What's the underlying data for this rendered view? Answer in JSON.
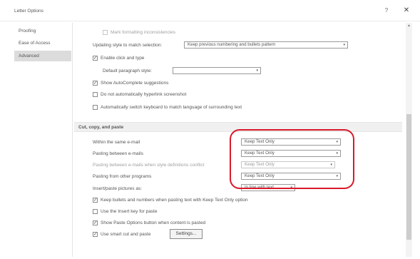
{
  "window": {
    "title": "Letter Options",
    "help_icon": "?",
    "close_icon": "✕"
  },
  "sidebar": {
    "items": [
      {
        "label": "Proofing",
        "active": false
      },
      {
        "label": "Ease of Access",
        "active": false
      },
      {
        "label": "Advanced",
        "active": true
      }
    ]
  },
  "editing": {
    "show_formatting_inconsistencies": {
      "label": "Mark formatting inconsistencies",
      "checked": false,
      "enabled": false
    },
    "updating_style": {
      "label": "Updating style to match selection:",
      "value": "Keep previous numbering and bullets pattern"
    },
    "enable_click_and_type": {
      "label": "Enable click and type",
      "checked": true
    },
    "default_paragraph_style": {
      "label": "Default paragraph style:",
      "value": ""
    },
    "show_autocomplete": {
      "label": "Show AutoComplete suggestions",
      "checked": true
    },
    "no_auto_hyperlink": {
      "label": "Do not automatically hyperlink screenshot",
      "checked": false
    },
    "auto_switch_keyboard": {
      "label": "Automatically switch keyboard to match language of surrounding text",
      "checked": false
    }
  },
  "cut_copy_paste": {
    "section_title": "Cut, copy, and paste",
    "rows": [
      {
        "label": "Within the same e-mail",
        "value": "Keep Text Only",
        "enabled": true
      },
      {
        "label": "Pasting between e-mails",
        "value": "Keep Text Only",
        "enabled": true
      },
      {
        "label": "Pasting between e-mails when style definitions conflict",
        "value": "Keep Text Only",
        "enabled": false
      },
      {
        "label": "Pasting from other programs",
        "value": "Keep Text Only",
        "enabled": true
      }
    ],
    "insert_paste_pictures": {
      "label": "Insert/paste pictures as:",
      "value": "In line with text"
    },
    "keep_bullets": {
      "label": "Keep bullets and numbers when pasting text with Keep Text Only option",
      "checked": true
    },
    "use_insert_key": {
      "label": "Use the Insert key for paste",
      "checked": false
    },
    "show_paste_options": {
      "label": "Show Paste Options button when content is pasted",
      "checked": true
    },
    "smart_cut_paste": {
      "label": "Use smart cut and paste",
      "checked": true
    },
    "settings_button": "Settings..."
  },
  "icons": {
    "dropdown_arrow": "▾",
    "scroll_up": "▲"
  },
  "colors": {
    "annotation": "#d91a2a",
    "active_nav": "#dcdcdc",
    "section_header": "#f0f0f0"
  }
}
